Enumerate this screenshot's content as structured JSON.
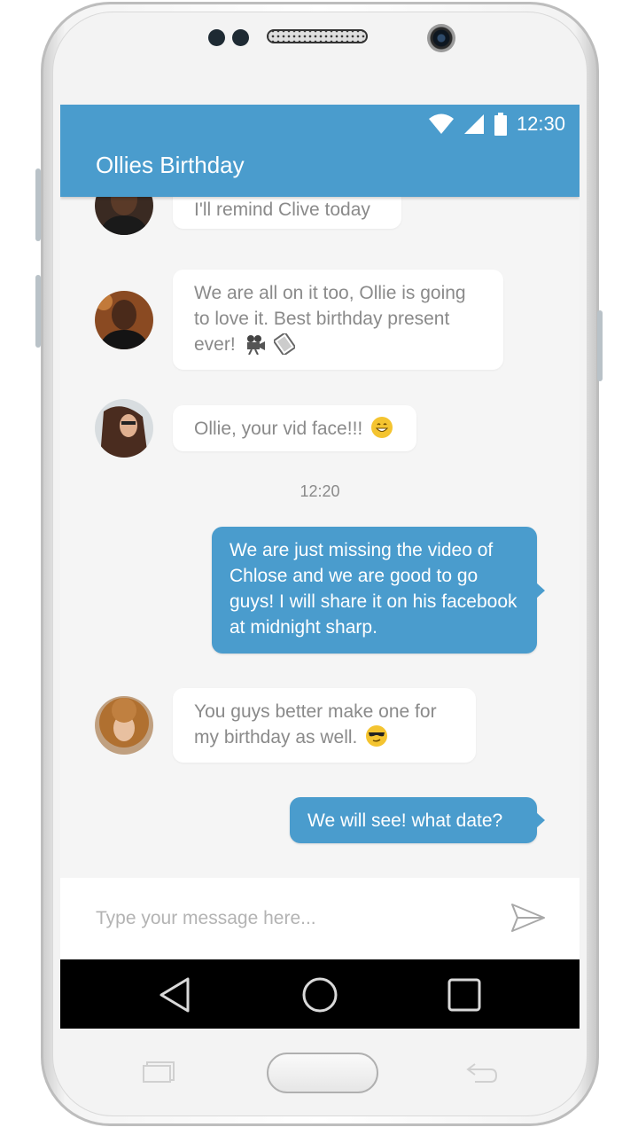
{
  "status_bar": {
    "time": "12:30"
  },
  "header": {
    "title": "Ollies Birthday"
  },
  "messages": [
    {
      "direction": "in",
      "text": "I'll remind Clive today"
    },
    {
      "direction": "in",
      "text": "We are all on it too, Ollie is going to love it. Best birthday present ever!",
      "emoji": [
        "movie-camera-icon",
        "film-strip-icon"
      ]
    },
    {
      "direction": "in",
      "text": "Ollie, your vid face!!!",
      "emoji": [
        "grinning-face-icon"
      ]
    },
    {
      "direction": "out",
      "text": "We are just missing the video of Chlose and we are good to go guys! I will share it on his facebook at midnight sharp."
    },
    {
      "direction": "in",
      "text": "You guys better make one for my birthday as well.",
      "emoji": [
        "sunglasses-face-icon"
      ]
    },
    {
      "direction": "out",
      "text": "We will see! what date?"
    }
  ],
  "timestamp": "12:20",
  "composer": {
    "placeholder": "Type your message here..."
  },
  "colors": {
    "accent": "#4a9ccd",
    "background": "#f5f5f5",
    "incoming_text": "#8a8a8a"
  }
}
